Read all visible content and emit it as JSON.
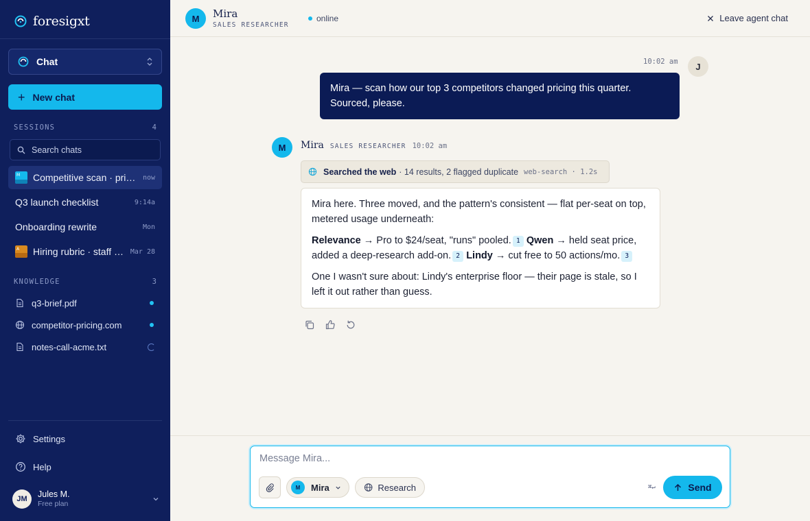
{
  "sidebar": {
    "brand": "foresigxt",
    "mode": "Chat",
    "new_chat": "New chat",
    "sessions_heading": "SESSIONS",
    "sessions_count": "4",
    "search_placeholder": "Search chats",
    "sessions": [
      {
        "title": "Competitive scan · pricing",
        "time": "now",
        "thumb_color": "#14b8ec",
        "thumb_letter": "M",
        "active": true
      },
      {
        "title": "Q3 launch checklist",
        "time": "9:14a"
      },
      {
        "title": "Onboarding rewrite",
        "time": "Mon"
      },
      {
        "title": "Hiring rubric · staff eng",
        "time": "Mar 28",
        "thumb_color": "#d98a1f",
        "thumb_letter": "A"
      }
    ],
    "knowledge_heading": "KNOWLEDGE",
    "knowledge_count": "3",
    "knowledge": [
      {
        "name": "q3-brief.pdf",
        "icon": "file-icon",
        "status": "ready"
      },
      {
        "name": "competitor-pricing.com",
        "icon": "globe-icon",
        "status": "ready"
      },
      {
        "name": "notes-call-acme.txt",
        "icon": "file-icon",
        "status": "indexing"
      }
    ],
    "settings": "Settings",
    "help": "Help",
    "user": {
      "initials": "JM",
      "name": "Jules M.",
      "plan": "Free plan"
    }
  },
  "header": {
    "avatar": "M",
    "agent_name": "Mira",
    "agent_role": "SALES RESEARCHER",
    "status": "online",
    "leave": "Leave agent chat"
  },
  "conversation": {
    "user_message": {
      "avatar": "J",
      "time": "10:02 am",
      "text": "Mira — scan how our top 3 competitors changed pricing this quarter. Sourced, please."
    },
    "agent_message": {
      "avatar": "M",
      "name": "Mira",
      "role": "SALES RESEARCHER",
      "time": "10:02 am",
      "tool": {
        "label": "Searched the web",
        "detail": "· 14 results, 2 flagged duplicate",
        "meta": "web-search · 1.2s"
      },
      "intro": "Mira here. Three moved, and the pattern's consistent — flat per-seat on top, metered usage underneath:",
      "items": [
        {
          "company": "Relevance",
          "text": " → Pro to $24/seat, \"runs\" pooled.",
          "cite": "1"
        },
        {
          "company": "Qwen",
          "text": " → held seat price, added a deep-research add-on.",
          "cite": "2"
        },
        {
          "company": "Lindy",
          "text": " → cut free to 50 actions/mo.",
          "cite": "3"
        }
      ],
      "outro": "One I wasn't sure about: Lindy's enterprise floor — their page is stale, so I left it out rather than guess."
    }
  },
  "composer": {
    "placeholder": "Message Mira...",
    "agent": "Mira",
    "agent_avatar": "M",
    "research": "Research",
    "shortcut": "⌘↵",
    "send": "Send"
  },
  "colors": {
    "sidebar_bg": "#0f1f5c",
    "accent": "#14b8ec",
    "user_bubble": "#0b1b55",
    "canvas": "#f6f4ef"
  }
}
